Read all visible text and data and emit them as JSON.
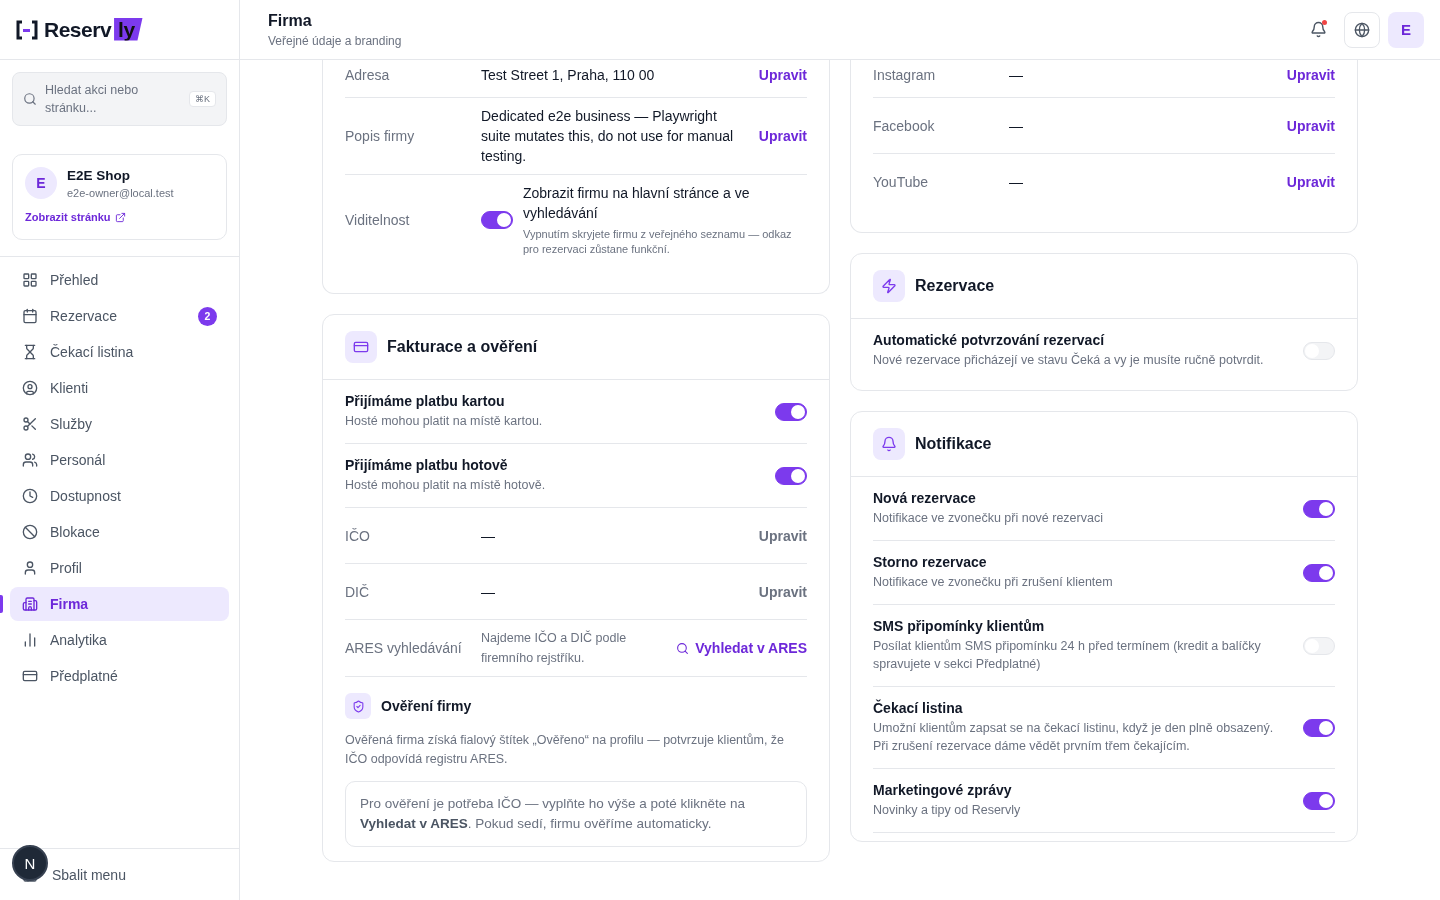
{
  "logo": {
    "text": "Reserv",
    "highlight": "ly"
  },
  "search": {
    "placeholder": "Hledat akci nebo stránku...",
    "shortcut": "⌘K"
  },
  "account": {
    "initial": "E",
    "name": "E2E Shop",
    "email": "e2e-owner@local.test",
    "link": "Zobrazit stránku"
  },
  "nav": [
    {
      "label": "Přehled",
      "selected": false
    },
    {
      "label": "Rezervace",
      "selected": false,
      "badge": "2"
    },
    {
      "label": "Čekací listina",
      "selected": false
    },
    {
      "label": "Klienti",
      "selected": false
    },
    {
      "label": "Služby",
      "selected": false
    },
    {
      "label": "Personál",
      "selected": false
    },
    {
      "label": "Dostupnost",
      "selected": false
    },
    {
      "label": "Blokace",
      "selected": false
    },
    {
      "label": "Profil",
      "selected": false
    },
    {
      "label": "Firma",
      "selected": true
    },
    {
      "label": "Analytika",
      "selected": false
    },
    {
      "label": "Předplatné",
      "selected": false
    }
  ],
  "collapse": "Sbalit menu",
  "dev_badge": "N",
  "header": {
    "title": "Firma",
    "subtitle": "Veřejné údaje a branding",
    "has_notification": true,
    "avatar": "E"
  },
  "left_column": [
    {
      "kind": "plain",
      "rows": [
        {
          "kind": "field",
          "label": "Adresa",
          "value": "Test Street 1, Praha, 110 00",
          "action": "Upravit",
          "disabled": false
        },
        {
          "kind": "field",
          "label": "Popis firmy",
          "value": "Dedicated e2e business — Playwright suite mutates this, do not use for manual testing.",
          "action": "Upravit",
          "disabled": false
        },
        {
          "kind": "toggle_field",
          "label": "Viditelnost",
          "on": true,
          "text": "Zobrazit firmu na hlavní stránce a ve vyhledávání",
          "hint": "Vypnutím skryjete firmu z veřejného seznamu — odkaz pro rezervaci zůstane funkční."
        }
      ]
    },
    {
      "kind": "billing",
      "title": "Fakturace a ověření",
      "rows": [
        {
          "kind": "setting",
          "title": "Přijímáme platbu kartou",
          "description": "Hosté mohou platit na místě kartou.",
          "on": true
        },
        {
          "kind": "setting",
          "title": "Přijímáme platbu hotově",
          "description": "Hosté mohou platit na místě hotově.",
          "on": true
        },
        {
          "kind": "field",
          "label": "IČO",
          "value": "—",
          "action": "Upravit",
          "disabled": true
        },
        {
          "kind": "field",
          "label": "DIČ",
          "value": "—",
          "action": "Upravit",
          "disabled": true
        },
        {
          "kind": "ares",
          "label": "ARES vyhledávání",
          "text": "Najdeme IČO a DIČ podle firemního rejstříku.",
          "action": "Vyhledat v ARES"
        },
        {
          "kind": "verification",
          "title": "Ověření firmy",
          "text": "Ověřená firma získá fialový štítek „Ověřeno“ na profilu — potvrzuje klientům, že IČO odpovídá registru ARES.",
          "note": "Pro ověření je potřeba IČO — vyplňte ho výše a poté klikněte na **Vyhledat v ARES**. Pokud sedí, firmu ověříme automaticky."
        }
      ]
    }
  ],
  "right_column": [
    {
      "kind": "plain",
      "rows": [
        {
          "kind": "field",
          "label": "Instagram",
          "value": "—",
          "action": "Upravit",
          "disabled": false
        },
        {
          "kind": "field",
          "label": "Facebook",
          "value": "—",
          "action": "Upravit",
          "disabled": false
        },
        {
          "kind": "field",
          "label": "YouTube",
          "value": "—",
          "action": "Upravit",
          "disabled": false
        }
      ]
    },
    {
      "kind": "reservations",
      "title": "Rezervace",
      "rows": [
        {
          "kind": "setting",
          "title": "Automatické potvrzování rezervací",
          "description": "Nové rezervace přicházejí ve stavu Čeká a vy je musíte ručně potvrdit.",
          "on": false
        }
      ]
    },
    {
      "kind": "notifications",
      "title": "Notifikace",
      "rows": [
        {
          "kind": "setting",
          "title": "Nová rezervace",
          "description": "Notifikace ve zvonečku při nové rezervaci",
          "on": true
        },
        {
          "kind": "setting",
          "title": "Storno rezervace",
          "description": "Notifikace ve zvonečku při zrušení klientem",
          "on": true
        },
        {
          "kind": "setting",
          "title": "SMS připomínky klientům",
          "description": "Posílat klientům SMS připomínku 24 h před termínem (kredit a balíčky spravujete v sekci Předplatné)",
          "on": false
        },
        {
          "kind": "setting",
          "title": "Čekací listina",
          "description": "Umožní klientům zapsat se na čekací listinu, když je den plně obsazený. Při zrušení rezervace dáme vědět prvním třem čekajícím.",
          "on": true
        },
        {
          "kind": "setting",
          "title": "Marketingové zprávy",
          "description": "Novinky a tipy od Reservly",
          "on": true
        }
      ]
    }
  ]
}
